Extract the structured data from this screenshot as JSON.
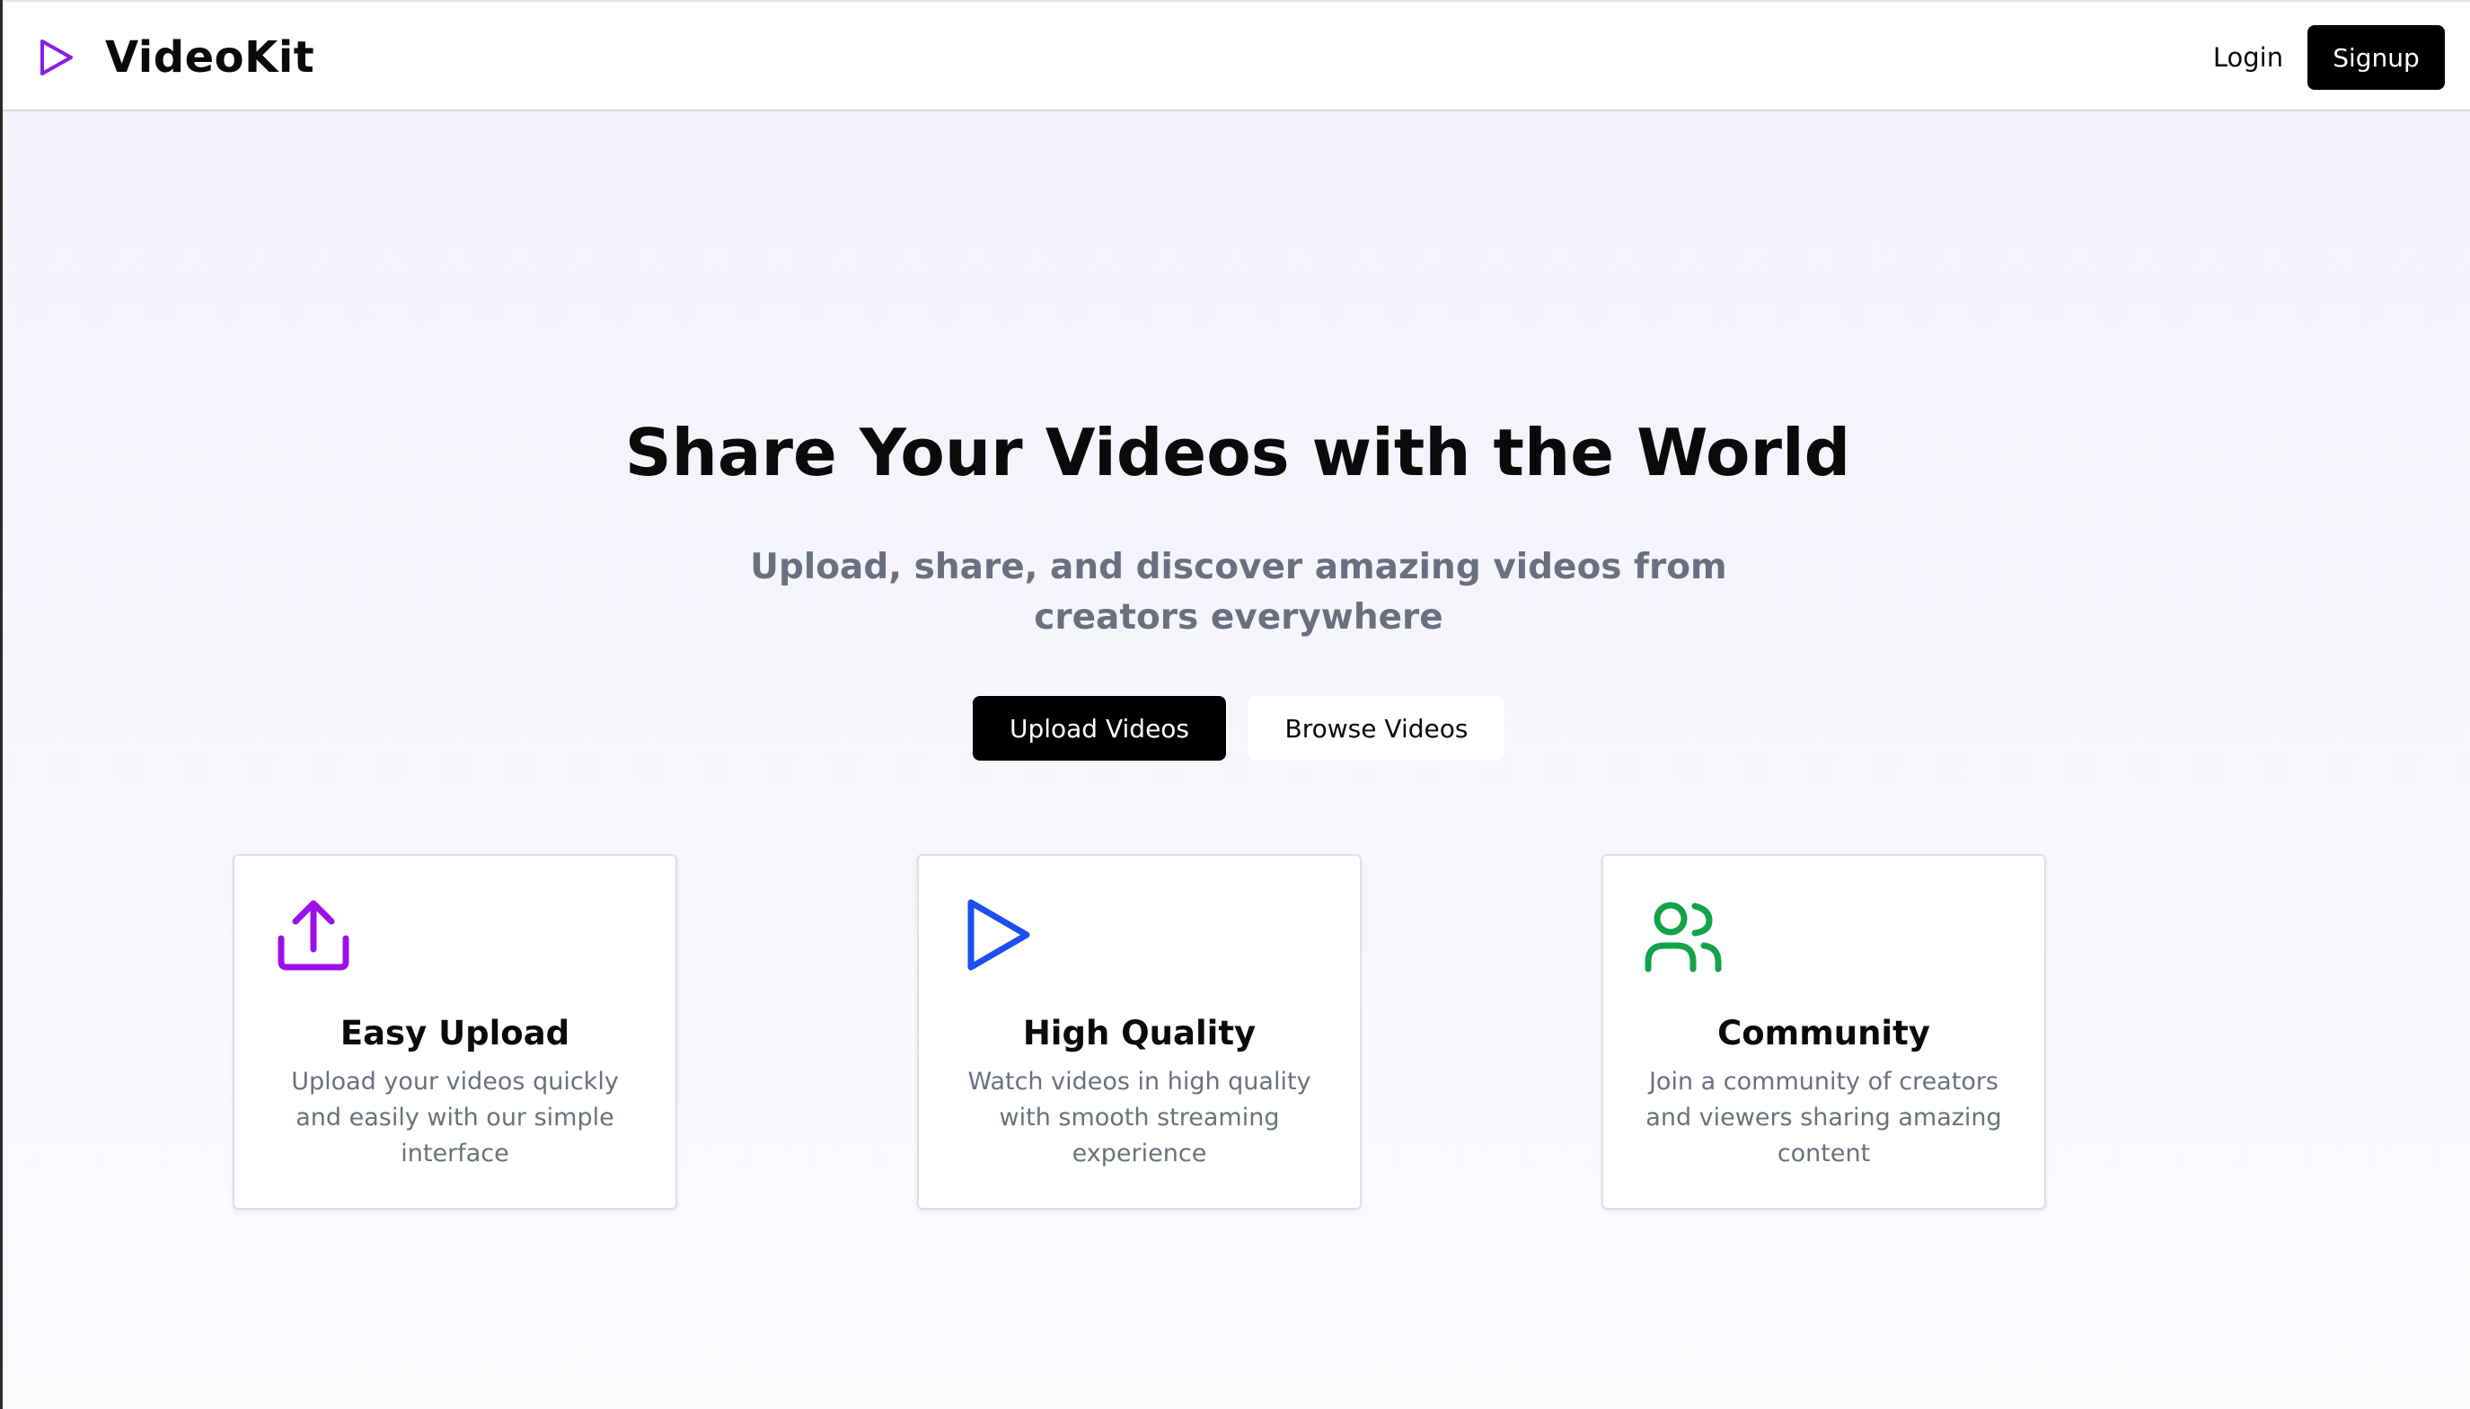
{
  "brand": {
    "name": "VideoKit",
    "icon": "play-icon",
    "accent": "#8b1ce8"
  },
  "nav": {
    "login_label": "Login",
    "signup_label": "Signup"
  },
  "hero": {
    "title": "Share Your Videos with the World",
    "subtitle": "Upload, share, and discover amazing videos from creators everywhere",
    "primary_cta": "Upload Videos",
    "secondary_cta": "Browse Videos"
  },
  "features": [
    {
      "icon": "upload-icon",
      "icon_color": "#9b10e6",
      "title": "Easy Upload",
      "text": "Upload your videos quickly and easily with our simple interface"
    },
    {
      "icon": "play-icon",
      "icon_color": "#1d4ff0",
      "title": "High Quality",
      "text": "Watch videos in high quality with smooth streaming experience"
    },
    {
      "icon": "users-icon",
      "icon_color": "#12a34a",
      "title": "Community",
      "text": "Join a community of creators and viewers sharing amazing content"
    }
  ]
}
